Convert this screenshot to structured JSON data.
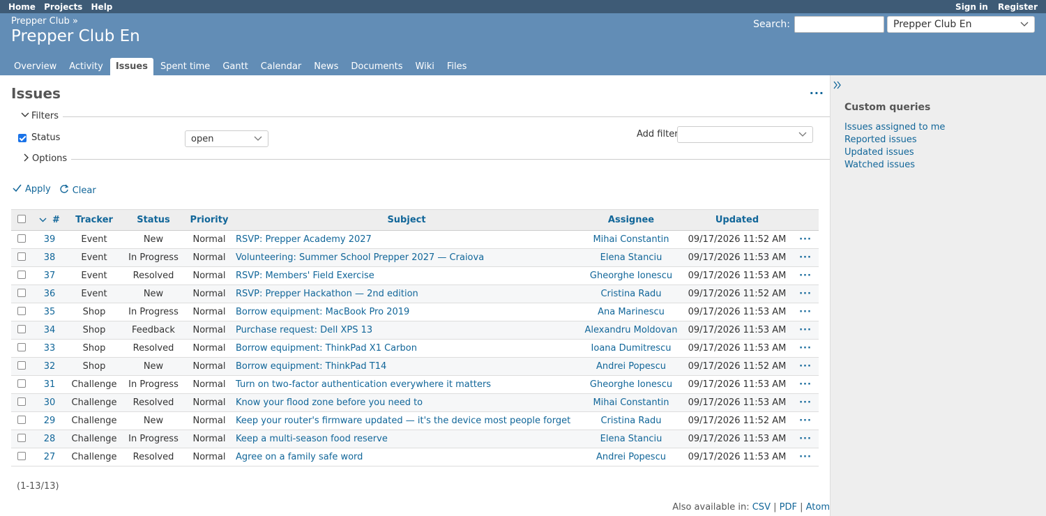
{
  "top_menu": {
    "left": [
      "Home",
      "Projects",
      "Help"
    ],
    "right": [
      "Sign in",
      "Register"
    ]
  },
  "header": {
    "breadcrumb": "Prepper Club »",
    "title": "Prepper Club En",
    "search_label": "Search:",
    "project_select": "Prepper Club En"
  },
  "tabs": [
    "Overview",
    "Activity",
    "Issues",
    "Spent time",
    "Gantt",
    "Calendar",
    "News",
    "Documents",
    "Wiki",
    "Files"
  ],
  "content": {
    "title": "Issues",
    "filters_legend": "Filters",
    "status_label": "Status",
    "status_value": "open",
    "add_filter_label": "Add filter",
    "options_legend": "Options",
    "apply_label": "Apply",
    "clear_label": "Clear",
    "columns": [
      "#",
      "Tracker",
      "Status",
      "Priority",
      "Subject",
      "Assignee",
      "Updated"
    ],
    "rows": [
      {
        "id": "39",
        "tracker": "Event",
        "status": "New",
        "priority": "Normal",
        "subject": "RSVP: Prepper Academy 2027",
        "assignee": "Mihai Constantin",
        "updated": "09/17/2026 11:52 AM"
      },
      {
        "id": "38",
        "tracker": "Event",
        "status": "In Progress",
        "priority": "Normal",
        "subject": "Volunteering: Summer School Prepper 2027 — Craiova",
        "assignee": "Elena Stanciu",
        "updated": "09/17/2026 11:53 AM"
      },
      {
        "id": "37",
        "tracker": "Event",
        "status": "Resolved",
        "priority": "Normal",
        "subject": "RSVP: Members' Field Exercise",
        "assignee": "Gheorghe Ionescu",
        "updated": "09/17/2026 11:53 AM"
      },
      {
        "id": "36",
        "tracker": "Event",
        "status": "New",
        "priority": "Normal",
        "subject": "RSVP: Prepper Hackathon — 2nd edition",
        "assignee": "Cristina Radu",
        "updated": "09/17/2026 11:52 AM"
      },
      {
        "id": "35",
        "tracker": "Shop",
        "status": "In Progress",
        "priority": "Normal",
        "subject": "Borrow equipment: MacBook Pro 2019",
        "assignee": "Ana Marinescu",
        "updated": "09/17/2026 11:53 AM"
      },
      {
        "id": "34",
        "tracker": "Shop",
        "status": "Feedback",
        "priority": "Normal",
        "subject": "Purchase request: Dell XPS 13",
        "assignee": "Alexandru Moldovan",
        "updated": "09/17/2026 11:53 AM"
      },
      {
        "id": "33",
        "tracker": "Shop",
        "status": "Resolved",
        "priority": "Normal",
        "subject": "Borrow equipment: ThinkPad X1 Carbon",
        "assignee": "Ioana Dumitrescu",
        "updated": "09/17/2026 11:53 AM"
      },
      {
        "id": "32",
        "tracker": "Shop",
        "status": "New",
        "priority": "Normal",
        "subject": "Borrow equipment: ThinkPad T14",
        "assignee": "Andrei Popescu",
        "updated": "09/17/2026 11:52 AM"
      },
      {
        "id": "31",
        "tracker": "Challenge",
        "status": "In Progress",
        "priority": "Normal",
        "subject": "Turn on two-factor authentication everywhere it matters",
        "assignee": "Gheorghe Ionescu",
        "updated": "09/17/2026 11:53 AM"
      },
      {
        "id": "30",
        "tracker": "Challenge",
        "status": "Resolved",
        "priority": "Normal",
        "subject": "Know your flood zone before you need to",
        "assignee": "Mihai Constantin",
        "updated": "09/17/2026 11:53 AM"
      },
      {
        "id": "29",
        "tracker": "Challenge",
        "status": "New",
        "priority": "Normal",
        "subject": "Keep your router's firmware updated — it's the device most people forget",
        "assignee": "Cristina Radu",
        "updated": "09/17/2026 11:52 AM"
      },
      {
        "id": "28",
        "tracker": "Challenge",
        "status": "In Progress",
        "priority": "Normal",
        "subject": "Keep a multi-season food reserve",
        "assignee": "Elena Stanciu",
        "updated": "09/17/2026 11:53 AM"
      },
      {
        "id": "27",
        "tracker": "Challenge",
        "status": "Resolved",
        "priority": "Normal",
        "subject": "Agree on a family safe word",
        "assignee": "Andrei Popescu",
        "updated": "09/17/2026 11:53 AM"
      }
    ],
    "pagination": "(1-13/13)",
    "also_available": "Also available in:",
    "formats": [
      "CSV",
      "PDF",
      "Atom"
    ]
  },
  "sidebar": {
    "title": "Custom queries",
    "queries": [
      "Issues assigned to me",
      "Reported issues",
      "Updated issues",
      "Watched issues"
    ]
  }
}
